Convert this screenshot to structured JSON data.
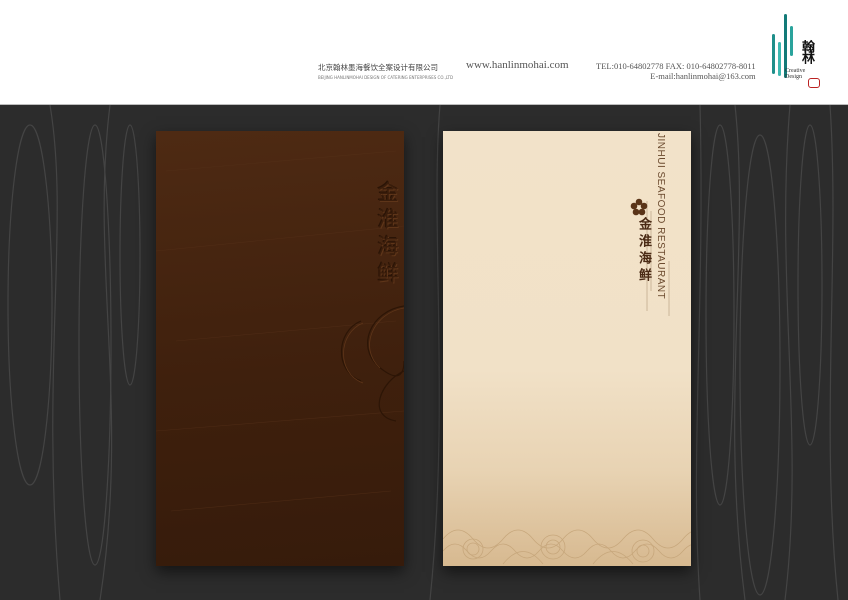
{
  "header": {
    "company_cn": "北京翰林墨海餐饮全案设计有限公司",
    "company_en": "BEIJING HANLINMOHAI DESIGN OF CATERING ENTERPRISES CO.,LTD",
    "website": "www.hanlinmohai.com",
    "tel_fax": "TEL:010-64802778  FAX: 010-64802778-8011",
    "email": "E-mail:hanlinmohai@163.com"
  },
  "logo": {
    "name_cn": "翰林",
    "tagline_line1": "Creative",
    "tagline_line2": "Design",
    "colors": [
      "#1f8f8a",
      "#2aa39c",
      "#137a78",
      "#3cb8b0"
    ]
  },
  "menu_covers": {
    "dark_cover": {
      "embossed_title_cn": "金淮海鲜",
      "color": "#4a2812"
    },
    "light_cover": {
      "title_en": "JINHUI SEAFOOD RESTAURANT",
      "title_cn": "金淮海鲜",
      "icon": "flower-icon",
      "color": "#f1e1c7"
    }
  }
}
